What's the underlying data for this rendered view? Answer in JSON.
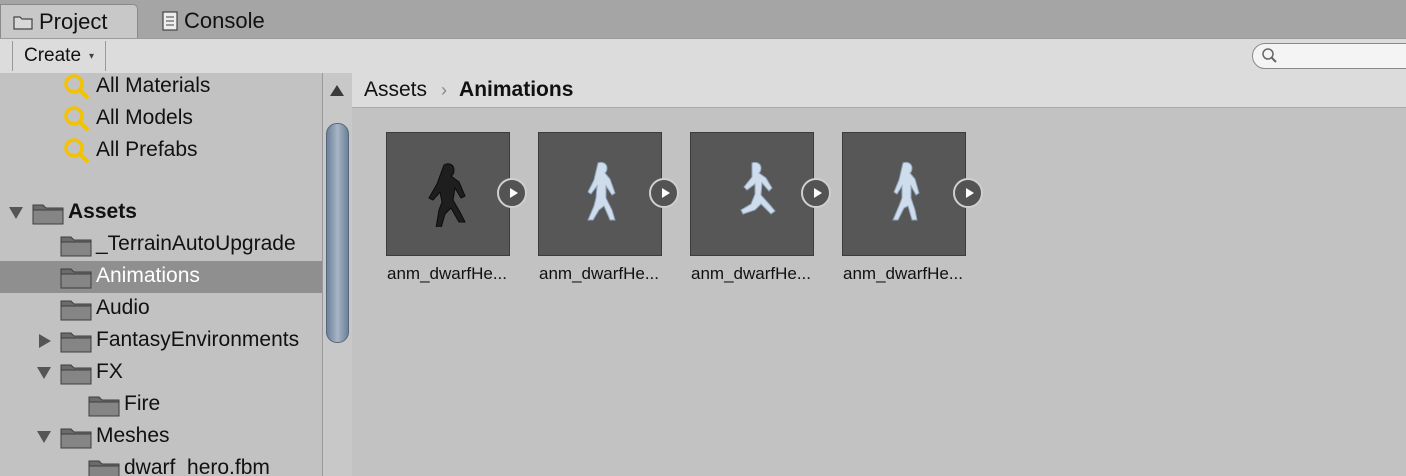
{
  "tabs": [
    {
      "label": "Project",
      "icon": "folder-icon"
    },
    {
      "label": "Console",
      "icon": "console-icon"
    }
  ],
  "toolbar": {
    "create_label": "Create",
    "create_arrow": "▾",
    "search_value": ""
  },
  "tree": [
    {
      "label": "All Materials",
      "kind": "search"
    },
    {
      "label": "All Models",
      "kind": "search"
    },
    {
      "label": "All Prefabs",
      "kind": "search"
    },
    {
      "label": "Assets",
      "kind": "folder"
    },
    {
      "label": "_TerrainAutoUpgrade",
      "kind": "folder"
    },
    {
      "label": "Animations",
      "kind": "folder",
      "selected": true
    },
    {
      "label": "Audio",
      "kind": "folder"
    },
    {
      "label": "FantasyEnvironments",
      "kind": "folder"
    },
    {
      "label": "FX",
      "kind": "folder"
    },
    {
      "label": "Fire",
      "kind": "folder"
    },
    {
      "label": "Meshes",
      "kind": "folder"
    },
    {
      "label": "dwarf_hero.fbm",
      "kind": "folder"
    }
  ],
  "breadcrumb": {
    "root": "Assets",
    "separator": "›",
    "current": "Animations"
  },
  "assets": [
    {
      "label": "anm_dwarfHe...",
      "style": "dark"
    },
    {
      "label": "anm_dwarfHe...",
      "style": "light"
    },
    {
      "label": "anm_dwarfHe...",
      "style": "light"
    },
    {
      "label": "anm_dwarfHe...",
      "style": "light"
    }
  ],
  "colors": {
    "selection": "#8f8f8f",
    "thumb_bg": "#575757",
    "scroll_thumb": "#8396ad"
  }
}
